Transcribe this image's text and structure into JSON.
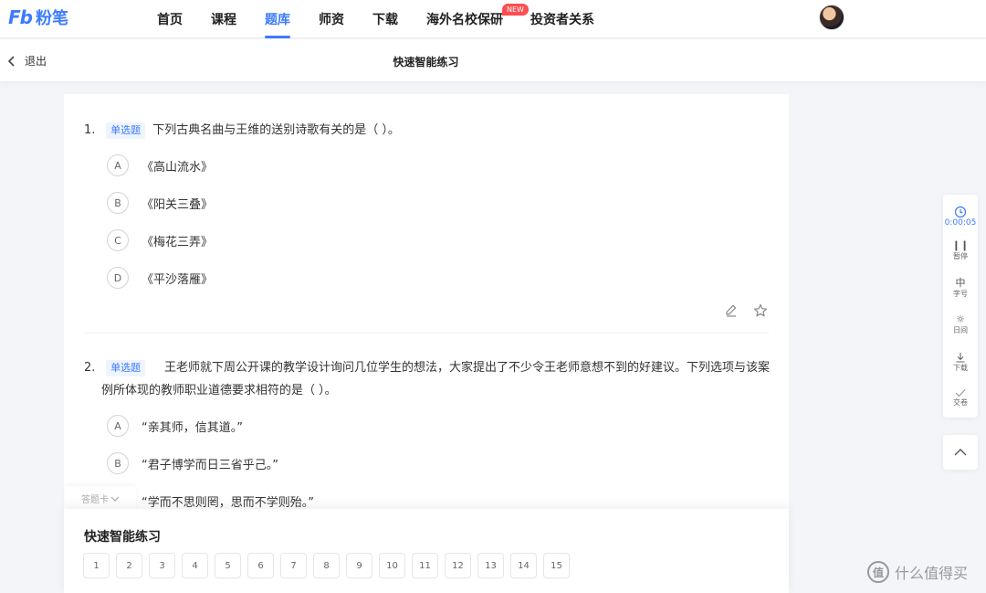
{
  "brand": {
    "logo_mark": "Fb",
    "logo_text": "粉笔",
    "accent_color": "#3c7cfc"
  },
  "nav": {
    "items": [
      "首页",
      "课程",
      "题库",
      "师资",
      "下载",
      "海外名校保研",
      "投资者关系"
    ],
    "active": "题库",
    "badge": "NEW"
  },
  "subheader": {
    "back_label": "退出",
    "title": "快速智能练习"
  },
  "questions": [
    {
      "number": "1.",
      "type": "单选题",
      "text": "下列古典名曲与王维的送别诗歌有关的是（ ）。",
      "options": [
        {
          "letter": "A",
          "text": "《高山流水》"
        },
        {
          "letter": "B",
          "text": "《阳关三叠》"
        },
        {
          "letter": "C",
          "text": "《梅花三弄》"
        },
        {
          "letter": "D",
          "text": "《平沙落雁》"
        }
      ]
    },
    {
      "number": "2.",
      "type": "单选题",
      "text": "王老师就下周公开课的教学设计询问几位学生的想法，大家提出了不少令王老师意想不到的好建议。下列选项与该案例所体现的教师职业道德要求相符的是（ ）。",
      "options": [
        {
          "letter": "A",
          "text": "“亲其师，信其道。”"
        },
        {
          "letter": "B",
          "text": "“君子博学而日三省乎己。”"
        },
        {
          "letter": "C",
          "text": "“学而不思则罔，思而不学则殆。”"
        }
      ]
    }
  ],
  "answer_sheet": {
    "tab_label": "答题卡",
    "title": "快速智能练习",
    "numbers": [
      "1",
      "2",
      "3",
      "4",
      "5",
      "6",
      "7",
      "8",
      "9",
      "10",
      "11",
      "12",
      "13",
      "14",
      "15"
    ]
  },
  "tools": {
    "timer": "0:00:05",
    "pause": "暂停",
    "font": "字号",
    "font_icon": "中",
    "day": "日间",
    "download": "下载",
    "submit": "交卷"
  },
  "watermark": {
    "mark": "值",
    "text": "什么值得买"
  }
}
